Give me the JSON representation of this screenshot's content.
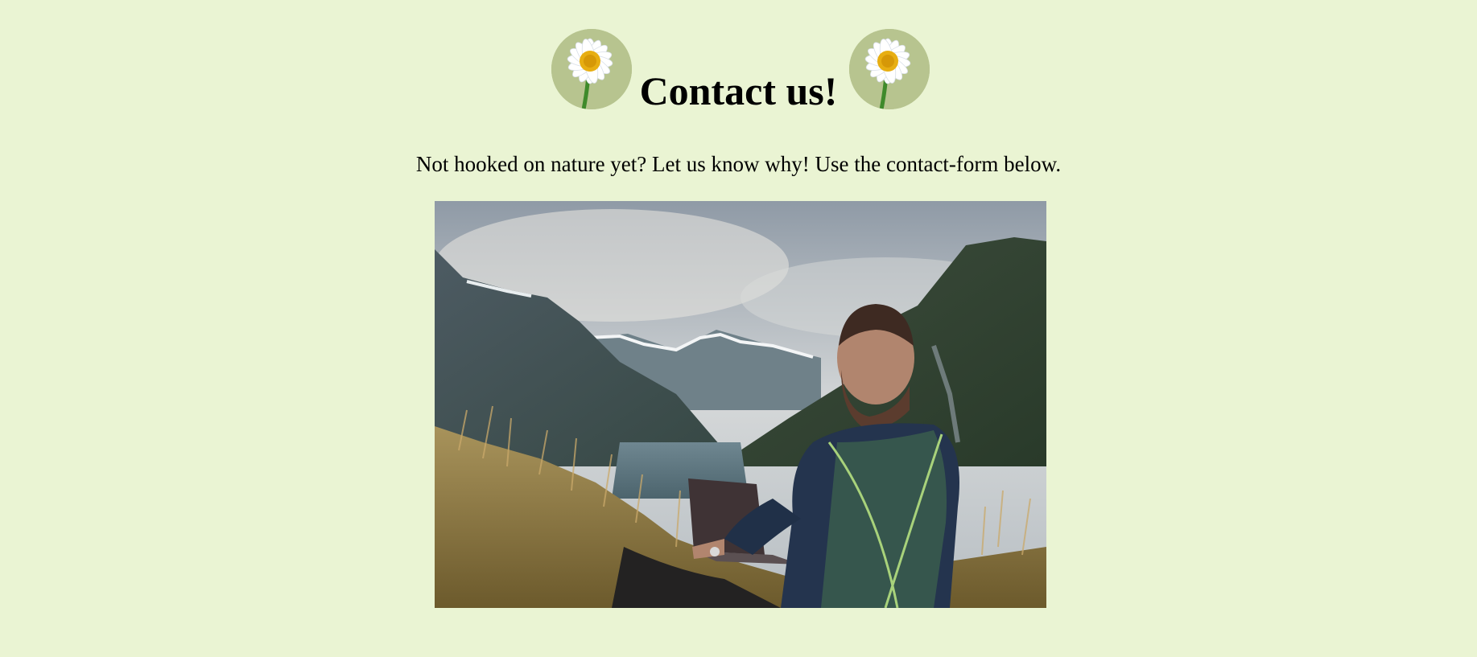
{
  "page": {
    "background_color": "#eaf4d3",
    "title": "Contact us!",
    "intro": "Not hooked on nature yet? Let us know why! Use the contact-form below."
  },
  "decorations": {
    "left_icon": "daisy-icon",
    "right_icon": "daisy-icon"
  },
  "hero_image": {
    "subject": "man with laptop overlooking fjord"
  }
}
